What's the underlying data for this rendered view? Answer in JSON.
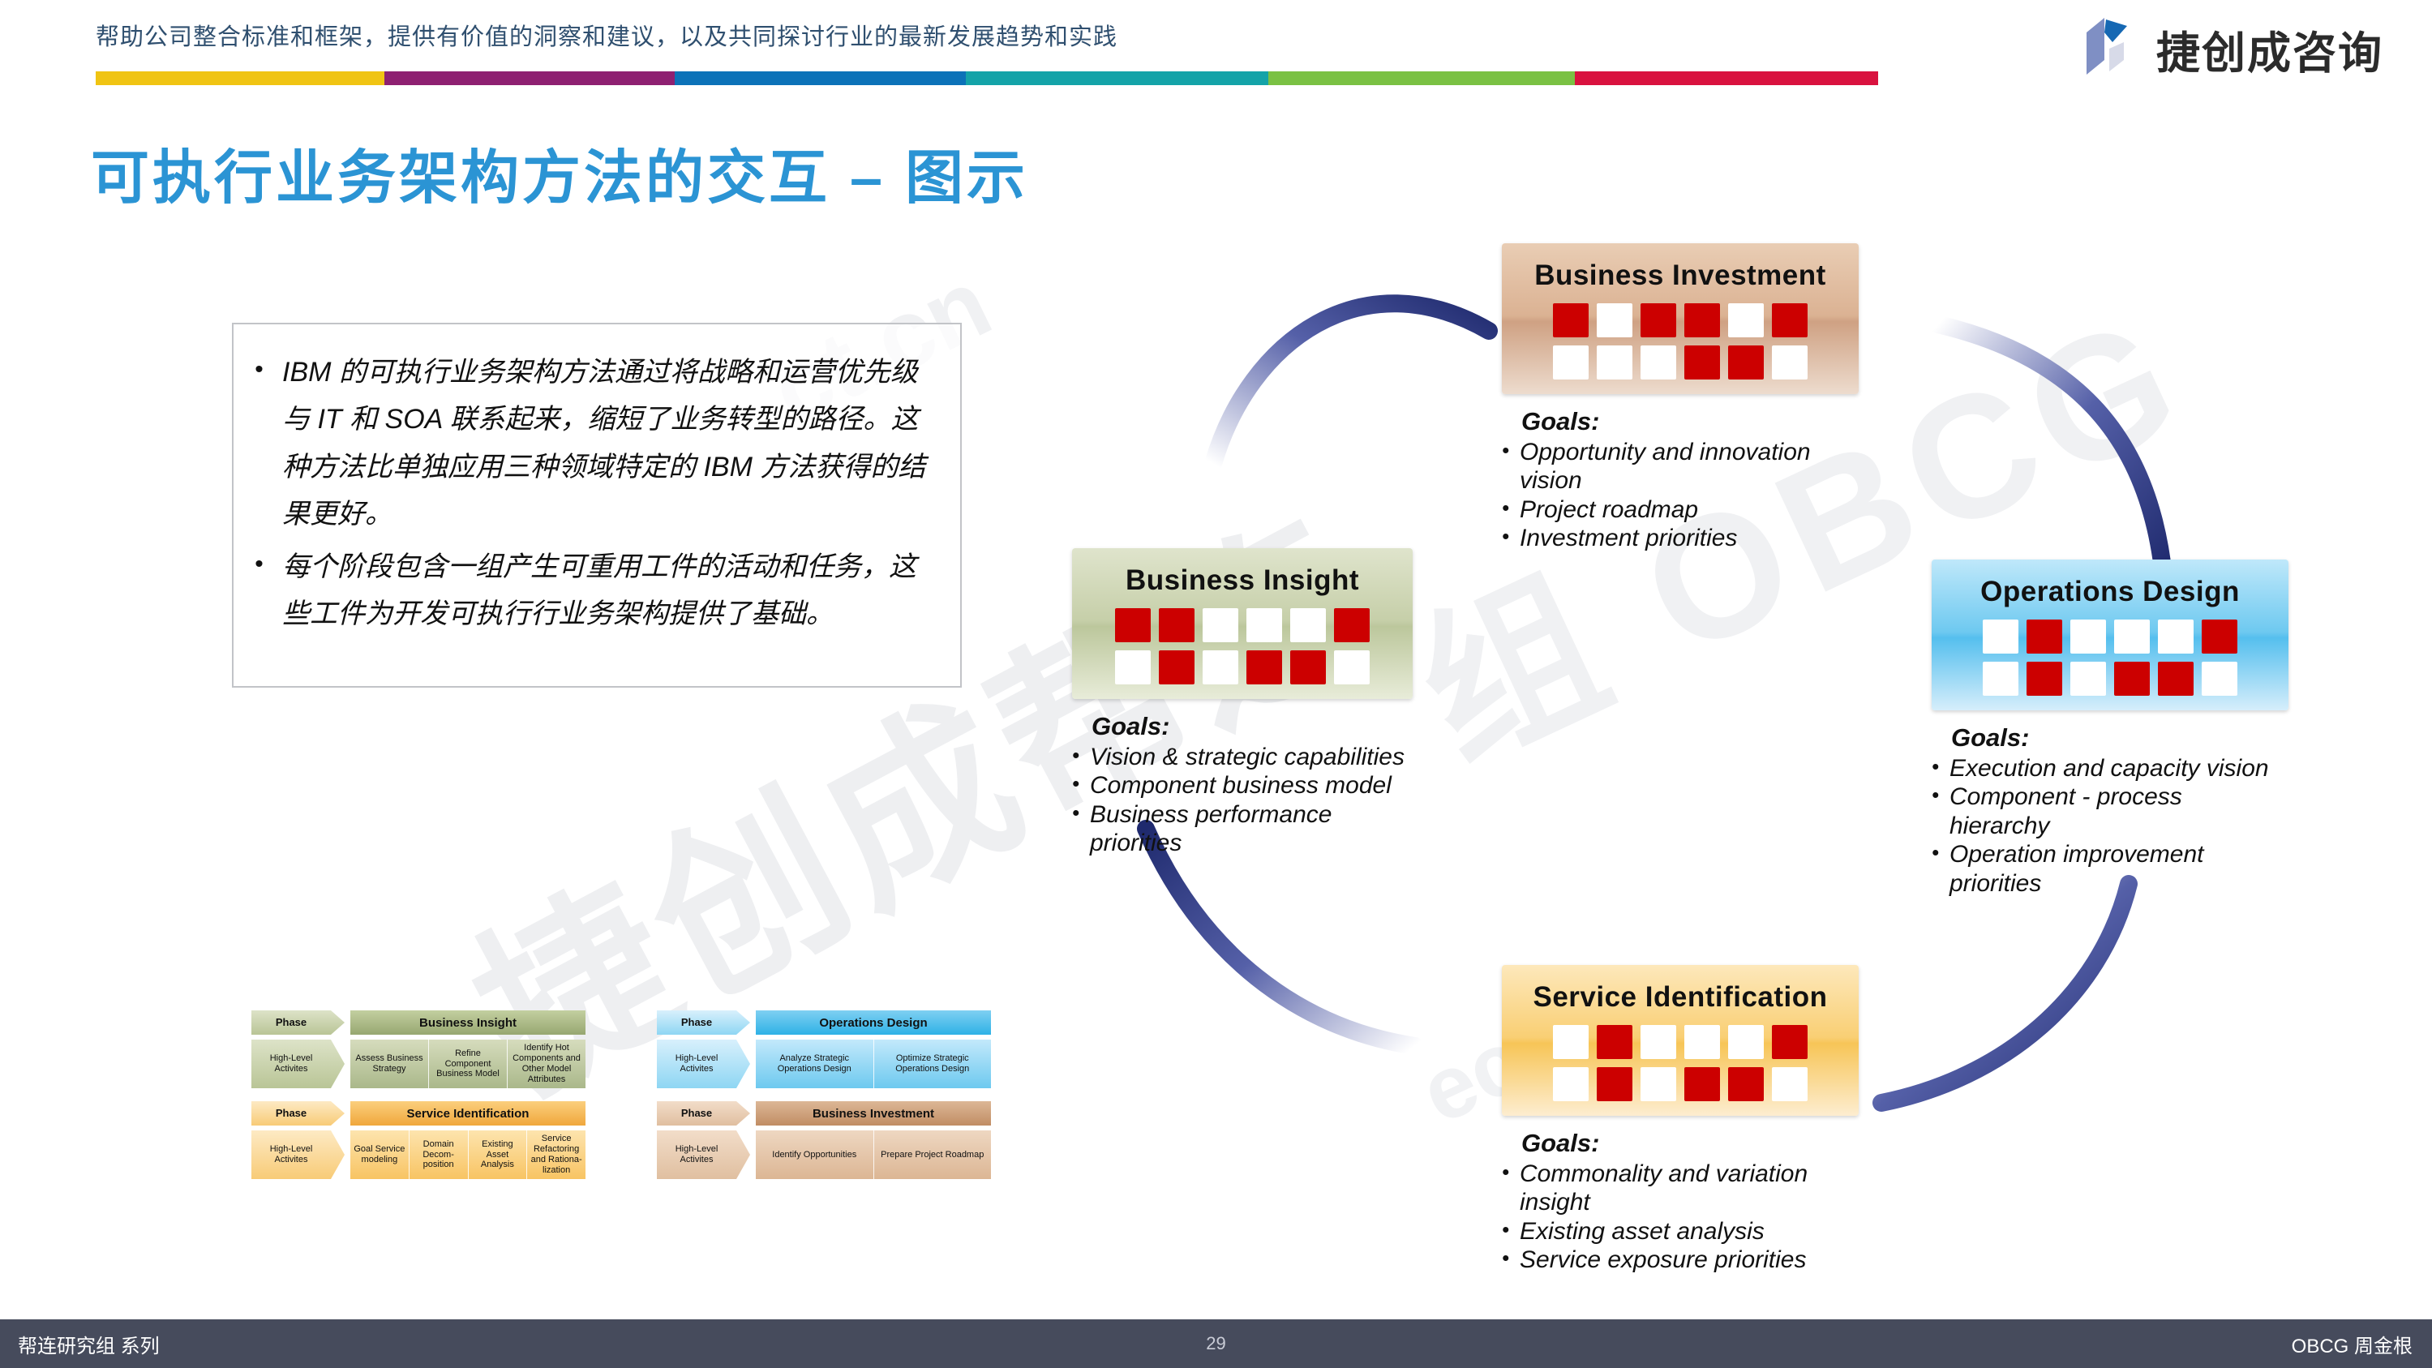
{
  "header": {
    "tagline": "帮助公司整合标准和框架，提供有价值的洞察和建议，以及共同探讨行业的最新发展趋势和实践",
    "rule_colors": [
      "#f0c413",
      "#8e2071",
      "#0c72b8",
      "#14a3a8",
      "#7ac143",
      "#d9123f"
    ],
    "logo_text": "捷创成咨询",
    "logo_colors": {
      "dark_blue": "#1668b3",
      "mid_blue": "#7f8fc4",
      "light": "#d7dae8"
    }
  },
  "title": "可执行业务架构方法的交互 – 图示",
  "title_color": "#2b94d4",
  "textbox": {
    "bullet_glyph": "•",
    "items": [
      "IBM 的可执行业务架构方法通过将战略和运营优先级与 IT 和 SOA 联系起来，缩短了业务转型的路径。这种方法比单独应用三种领域特定的 IBM 方法获得的结果更好。",
      "每个阶段包含一组产生可重用工件的活动和任务，这些工件为开发可执行行业务架构提供了基础。"
    ]
  },
  "cycle": {
    "goals_label": "Goals:",
    "bullet_glyph": "•",
    "cell_colors": {
      "filled": "#cc0000",
      "empty": "#ffffff"
    },
    "nodes": [
      {
        "id": "business-investment",
        "title": "Business Investment",
        "accent": "#cfa183",
        "grid": [
          [
            "r",
            "w",
            "r",
            "r",
            "w",
            "r"
          ],
          [
            "w",
            "w",
            "w",
            "r",
            "r",
            "w"
          ]
        ],
        "goals": [
          "Opportunity and innovation vision",
          "Project roadmap",
          "Investment priorities"
        ]
      },
      {
        "id": "operations-design",
        "title": "Operations Design",
        "accent": "#55bfee",
        "grid": [
          [
            "w",
            "r",
            "w",
            "w",
            "w",
            "r"
          ],
          [
            "w",
            "r",
            "w",
            "r",
            "r",
            "w"
          ]
        ],
        "goals": [
          "Execution and capacity vision",
          "Component - process hierarchy",
          "Operation improvement priorities"
        ]
      },
      {
        "id": "service-identification",
        "title": "Service Identification",
        "accent": "#f7c557",
        "grid": [
          [
            "w",
            "r",
            "w",
            "w",
            "w",
            "r"
          ],
          [
            "w",
            "r",
            "w",
            "r",
            "r",
            "w"
          ]
        ],
        "goals": [
          "Commonality and variation insight",
          "Existing asset analysis",
          "Service exposure priorities"
        ]
      },
      {
        "id": "business-insight",
        "title": "Business Insight",
        "accent": "#bcc79c",
        "grid": [
          [
            "r",
            "r",
            "w",
            "w",
            "w",
            "r"
          ],
          [
            "w",
            "r",
            "w",
            "r",
            "r",
            "w"
          ]
        ],
        "goals": [
          "Vision & strategic capabilities",
          "Component business model",
          "Business performance priorities"
        ]
      }
    ],
    "arrow_color_dark": "#1f2a6e",
    "arrow_color_light": "#ffffff"
  },
  "mini_diagram": {
    "phase_label": "Phase",
    "activities_label_line1": "High-Level",
    "activities_label_line2": "Activites",
    "panels": [
      {
        "id": "business-insight",
        "title": "Business Insight",
        "theme": "green",
        "activities": [
          "Assess Business Strategy",
          "Refine Component Business Model",
          "Identify Hot Components and Other Model Attributes"
        ]
      },
      {
        "id": "service-identification",
        "title": "Service Identification",
        "theme": "orange",
        "activities": [
          "Goal Service modeling",
          "Domain Decom-position",
          "Existing Asset Analysis",
          "Service Refactoring and Rationa-lization"
        ]
      },
      {
        "id": "operations-design",
        "title": "Operations Design",
        "theme": "blue",
        "activities": [
          "Analyze Strategic Operations Design",
          "Optimize Strategic Operations Design"
        ]
      },
      {
        "id": "business-investment",
        "title": "Business Investment",
        "theme": "tan",
        "activities": [
          "Identify Opportunities",
          "Prepare Project Roadmap"
        ]
      }
    ]
  },
  "watermarks": {
    "cn": "捷创成帮连",
    "obcg": "组 OBCG",
    "url1": "ct.cn",
    "url2": "ect.cn"
  },
  "footer": {
    "left": "帮连研究组 系列",
    "page": "29",
    "right": "OBCG 周金根",
    "bg": "#464b5c"
  }
}
